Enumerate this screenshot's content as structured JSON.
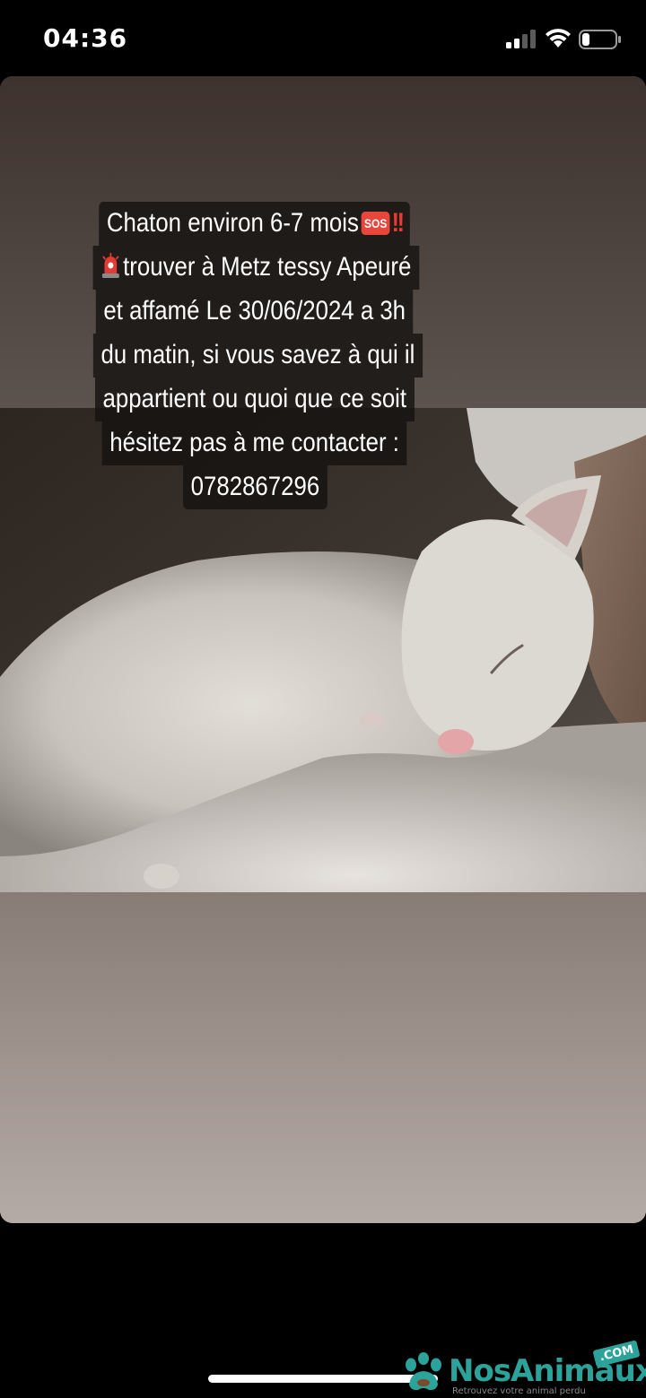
{
  "status_bar": {
    "time": "04:36",
    "icons": [
      "signal-icon",
      "wifi-icon",
      "battery-icon"
    ]
  },
  "story": {
    "caption": {
      "line1": "Chaton environ 6-7 mois",
      "sos_emoji": "SOS",
      "bang_emoji": "!!",
      "line2": "trouver à Metz tessy Apeuré",
      "line3": "et affamé  Le 30/06/2024 a 3h",
      "line4": "du matin, si vous savez à qui il",
      "line5": "appartient ou quoi que ce soit",
      "line6": "hésitez pas à me contacter :",
      "line7": "0782867296"
    }
  },
  "watermark": {
    "brand": "NosAnimaux",
    "com": ".COM",
    "tagline": "Retrouvez votre animal perdu"
  },
  "colors": {
    "brand": "#2ca39a",
    "sos": "#e8463b",
    "background": "#000000"
  }
}
